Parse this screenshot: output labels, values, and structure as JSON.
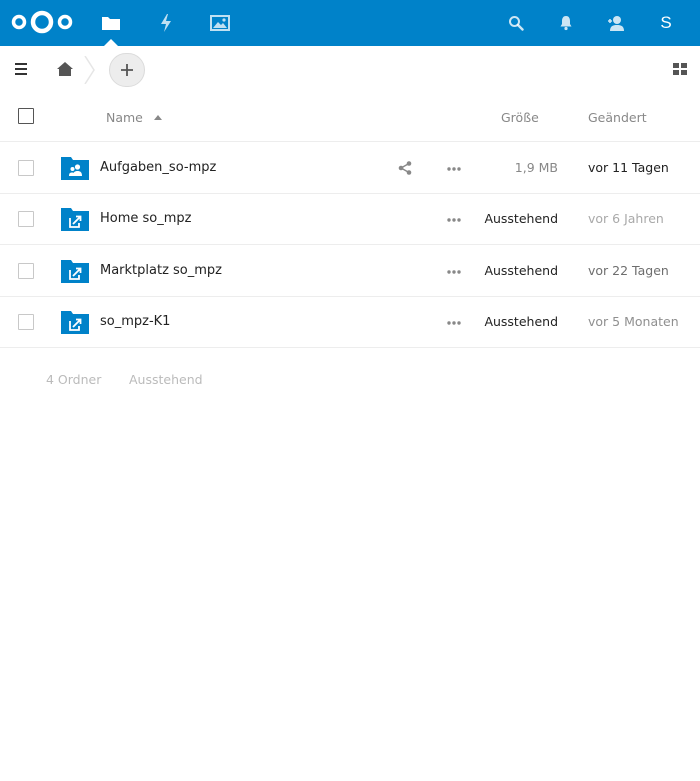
{
  "header": {
    "apps": [
      {
        "id": "files",
        "icon": "folder-icon",
        "active": true
      },
      {
        "id": "activity",
        "icon": "lightning-icon",
        "active": false
      },
      {
        "id": "gallery",
        "icon": "image-icon",
        "active": false
      }
    ],
    "right": [
      {
        "icon": "search-icon"
      },
      {
        "icon": "bell-icon"
      },
      {
        "icon": "contacts-icon"
      }
    ],
    "avatar_letter": "S",
    "bg_color": "#0082c9"
  },
  "table": {
    "columns": {
      "name": "Name",
      "size": "Größe",
      "modified": "Geändert"
    },
    "rows": [
      {
        "name": "Aufgaben_so-mpz",
        "folder_type": "shared-folder-icon",
        "size": "1,9 MB",
        "size_muted": true,
        "modified": "vor 11 Tagen",
        "date_color": "#222222",
        "shareable": true
      },
      {
        "name": "Home so_mpz",
        "folder_type": "external-folder-icon",
        "size": "Ausstehend",
        "size_muted": false,
        "modified": "vor 6 Jahren",
        "date_color": "#a9a9a9",
        "shareable": false
      },
      {
        "name": "Marktplatz so_mpz",
        "folder_type": "external-folder-icon",
        "size": "Ausstehend",
        "size_muted": false,
        "modified": "vor 22 Tagen",
        "date_color": "#6e6e6e",
        "shareable": false
      },
      {
        "name": "so_mpz-K1",
        "folder_type": "external-folder-icon",
        "size": "Ausstehend",
        "size_muted": false,
        "modified": "vor 5 Monaten",
        "date_color": "#8f8f8f",
        "shareable": false
      }
    ]
  },
  "summary": {
    "folders": "4 Ordner",
    "size": "Ausstehend"
  }
}
